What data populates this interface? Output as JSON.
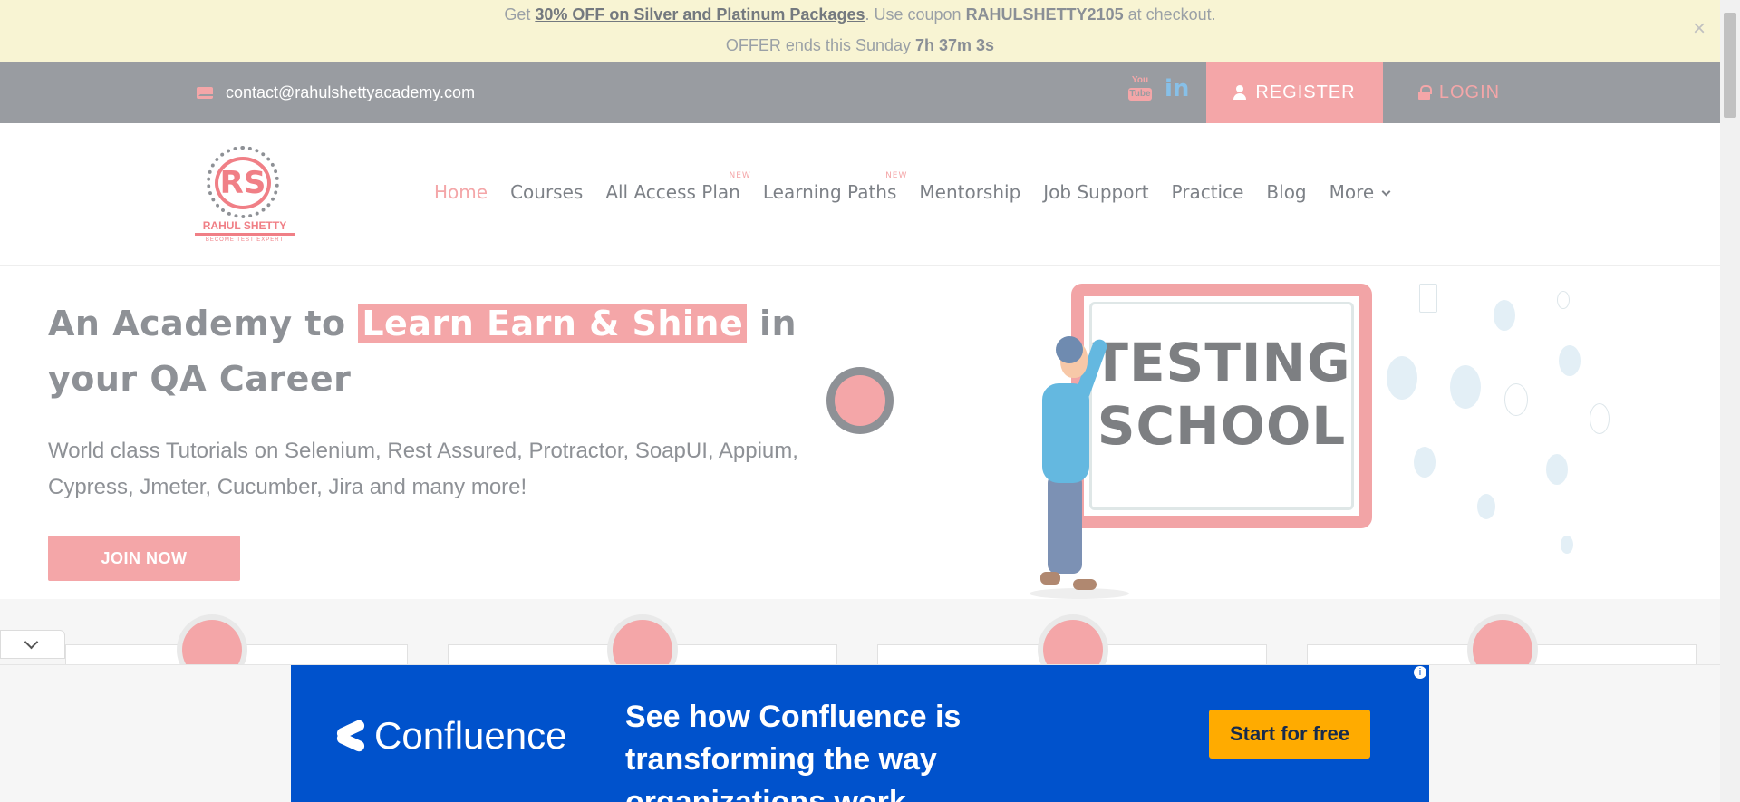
{
  "promo": {
    "get": "Get",
    "offer_link": "30% OFF on Silver and Platinum Packages",
    "use_coupon": ". Use coupon",
    "coupon": "RAHULSHETTY2105",
    "at_checkout": "at checkout.",
    "ends": "OFFER ends this Sunday",
    "countdown": "7h 37m 3s",
    "close": "×"
  },
  "topbar": {
    "email": "contact@rahulshettyacademy.com",
    "youtube_text": "You",
    "youtube_box": "Tube",
    "linkedin_text": "in",
    "register": "REGISTER",
    "login": "LOGIN"
  },
  "logo": {
    "mark": "RS",
    "name": "RAHUL SHETTY",
    "tagline": "BECOME TEST EXPERT"
  },
  "nav": {
    "items": [
      {
        "label": "Home"
      },
      {
        "label": "Courses"
      },
      {
        "label": "All Access Plan",
        "badge": "NEW"
      },
      {
        "label": "Learning Paths",
        "badge": "NEW"
      },
      {
        "label": "Mentorship"
      },
      {
        "label": "Job Support"
      },
      {
        "label": "Practice"
      },
      {
        "label": "Blog"
      },
      {
        "label": "More"
      }
    ]
  },
  "hero": {
    "title_pre": "An Academy to",
    "title_highlight": "Learn Earn & Shine",
    "title_post": " in your QA Career",
    "subtitle": "World class Tutorials on Selenium, Rest Assured, Protractor, SoapUI, Appium, Cypress, Jmeter, Cucumber, Jira and many more!",
    "cta": "JOIN NOW",
    "board_line1": "TESTING",
    "board_line2": "SCHOOL"
  },
  "ad": {
    "brand": "Confluence",
    "message": "See how Confluence is transforming the way organizations work",
    "cta": "Start for free",
    "info": "i"
  },
  "colors": {
    "accent": "#f4a6a8",
    "topbar": "#999ca1",
    "promo_bg": "#f8f4d3",
    "ad_blue": "#0052cc",
    "ad_cta": "#ffab00"
  }
}
